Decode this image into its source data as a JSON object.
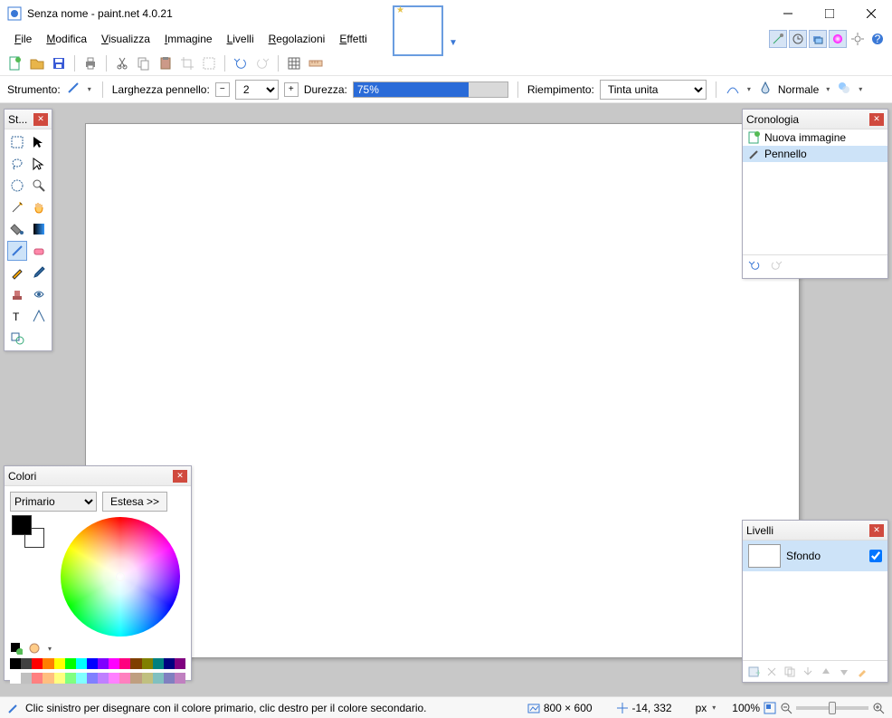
{
  "window": {
    "title": "Senza nome - paint.net 4.0.21"
  },
  "menu": [
    "File",
    "Modifica",
    "Visualizza",
    "Immagine",
    "Livelli",
    "Regolazioni",
    "Effetti"
  ],
  "options": {
    "tool_label": "Strumento:",
    "width_label": "Larghezza pennello:",
    "width_value": "2",
    "hardness_label": "Durezza:",
    "hardness_value": "75%",
    "fill_label": "Riempimento:",
    "fill_value": "Tinta unita",
    "blend_label": "Normale"
  },
  "panels": {
    "tools_title": "St...",
    "history_title": "Cronologia",
    "colors_title": "Colori",
    "layers_title": "Livelli"
  },
  "history": {
    "items": [
      "Nuova immagine",
      "Pennello"
    ]
  },
  "colors": {
    "which_label": "Primario",
    "expand_label": "Estesa >>"
  },
  "layers": {
    "item_name": "Sfondo"
  },
  "status": {
    "hint": "Clic sinistro per disegnare con il colore primario, clic destro per il colore secondario.",
    "dims": "800 × 600",
    "pos": "-14, 332",
    "unit": "px",
    "zoom": "100%"
  },
  "palette_top": [
    "#000",
    "#404040",
    "#ff0000",
    "#ff7f00",
    "#ffff00",
    "#00ff00",
    "#00ffff",
    "#0000ff",
    "#7f00ff",
    "#ff00ff",
    "#ff007f",
    "#7f3f00",
    "#808000",
    "#008080",
    "#000080",
    "#800080"
  ],
  "palette_bot": [
    "#fff",
    "#c0c0c0",
    "#ff8080",
    "#ffbf80",
    "#ffff80",
    "#80ff80",
    "#80ffff",
    "#8080ff",
    "#bf80ff",
    "#ff80ff",
    "#ff80bf",
    "#bf9f80",
    "#c0c080",
    "#80c0c0",
    "#8080c0",
    "#c080c0"
  ]
}
